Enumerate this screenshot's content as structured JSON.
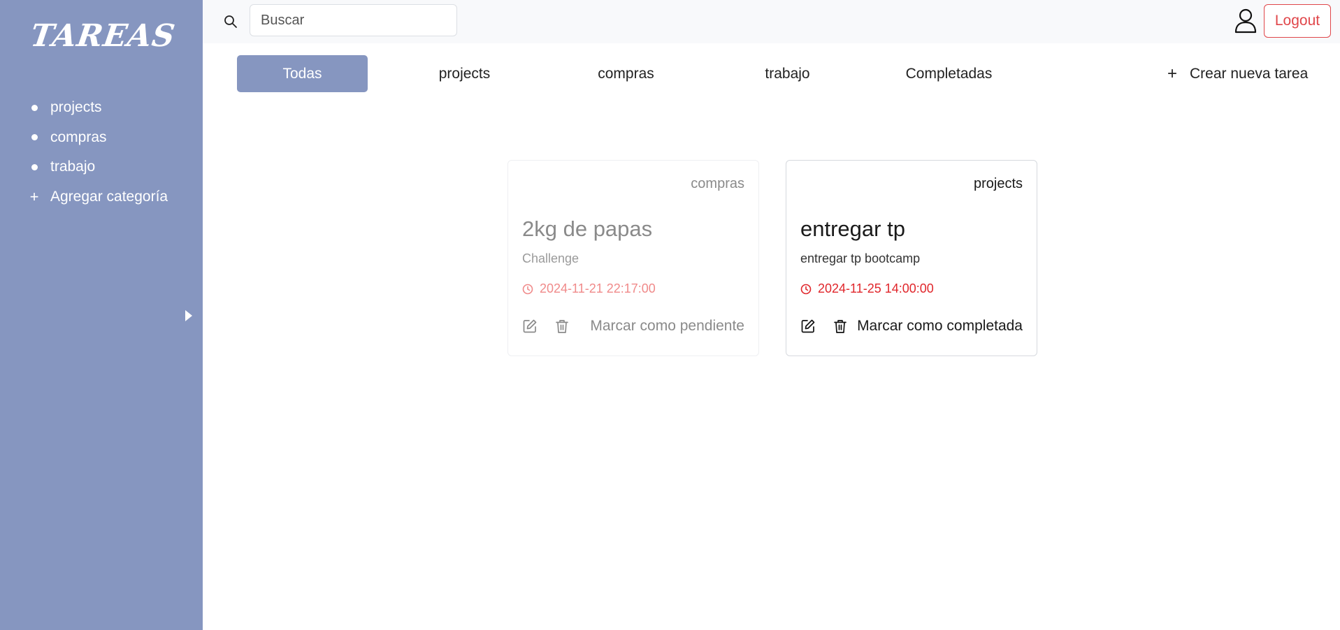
{
  "app": {
    "logo": "TAREAS"
  },
  "sidebar": {
    "categories": [
      {
        "label": "projects"
      },
      {
        "label": "compras"
      },
      {
        "label": "trabajo"
      }
    ],
    "add_category_label": "Agregar categoría"
  },
  "topbar": {
    "search_placeholder": "Buscar",
    "search_value": "",
    "logout_label": "Logout"
  },
  "tabs": [
    {
      "label": "Todas",
      "active": true
    },
    {
      "label": "projects",
      "active": false
    },
    {
      "label": "compras",
      "active": false
    },
    {
      "label": "trabajo",
      "active": false
    },
    {
      "label": "Completadas",
      "active": false
    }
  ],
  "create_task_label": "Crear nueva tarea",
  "tasks": [
    {
      "category": "compras",
      "title": "2kg de papas",
      "description": "Challenge",
      "due": "2024-11-21 22:17:00",
      "status_action": "Marcar como pendiente",
      "completed": true
    },
    {
      "category": "projects",
      "title": "entregar tp",
      "description": "entregar tp bootcamp",
      "due": "2024-11-25 14:00:00",
      "status_action": "Marcar como completada",
      "completed": false
    }
  ],
  "colors": {
    "sidebar_bg": "#8696c0",
    "accent": "#8696c0",
    "danger": "#e0262b",
    "logout": "#e0464a"
  }
}
